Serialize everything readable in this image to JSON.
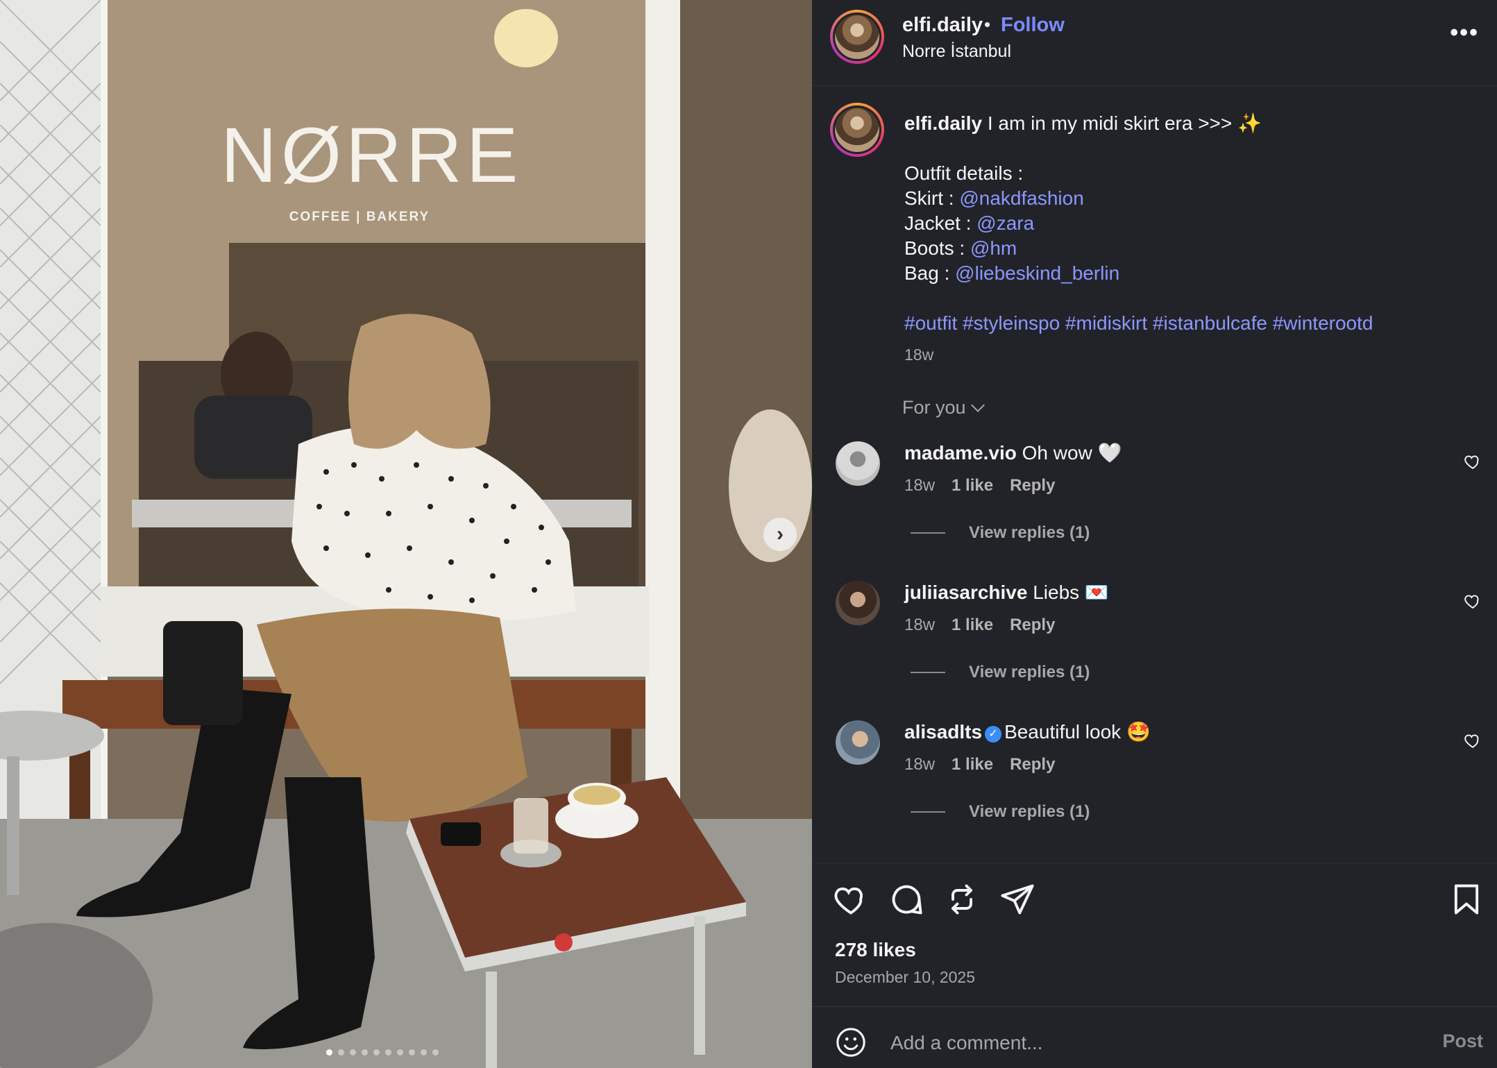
{
  "photo": {
    "sign_name": "NØRRE",
    "sign_sub": "COFFEE | BAKERY",
    "next_icon": "chevron-right-icon",
    "carousel_dots": 10,
    "active_dot": 0
  },
  "header": {
    "username": "elfi.daily",
    "separator": "•",
    "follow": "Follow",
    "location": "Norre İstanbul",
    "more": "•••"
  },
  "caption": {
    "username": "elfi.daily",
    "text": "I am in my midi skirt era >>> ✨",
    "outfit_title": "Outfit details :",
    "items": [
      {
        "label": "Skirt : ",
        "mention": "@nakdfashion"
      },
      {
        "label": "Jacket : ",
        "mention": "@zara"
      },
      {
        "label": "Boots : ",
        "mention": "@hm"
      },
      {
        "label": "Bag : ",
        "mention": "@liebeskind_berlin"
      }
    ],
    "hashtags": "#outfit #styleinspo #midiskirt #istanbulcafe #winterootd",
    "time": "18w"
  },
  "filter": {
    "label": "For you"
  },
  "comments": [
    {
      "username": "madame.vio",
      "text": "Oh wow 🤍",
      "verified": false,
      "time": "18w",
      "likes": "1 like",
      "reply": "Reply",
      "replies": "View replies (1)"
    },
    {
      "username": "juliiasarchive",
      "text": "Liebs 💌",
      "verified": false,
      "time": "18w",
      "likes": "1 like",
      "reply": "Reply",
      "replies": "View replies (1)"
    },
    {
      "username": "alisadlts",
      "text": "Beautiful look 🤩",
      "verified": true,
      "time": "18w",
      "likes": "1 like",
      "reply": "Reply",
      "replies": "View replies (1)"
    }
  ],
  "actions": {
    "icons": [
      "heart-icon",
      "comment-icon",
      "repost-icon",
      "share-icon",
      "bookmark-icon"
    ],
    "likes": "278 likes",
    "date": "December 10, 2025"
  },
  "composer": {
    "placeholder": "Add a comment...",
    "post": "Post"
  },
  "colors": {
    "panel_bg": "#212328",
    "link": "#8d97ff",
    "follow": "#7d8bff",
    "muted": "#a8a8a8",
    "verified": "#3a8ef6"
  }
}
